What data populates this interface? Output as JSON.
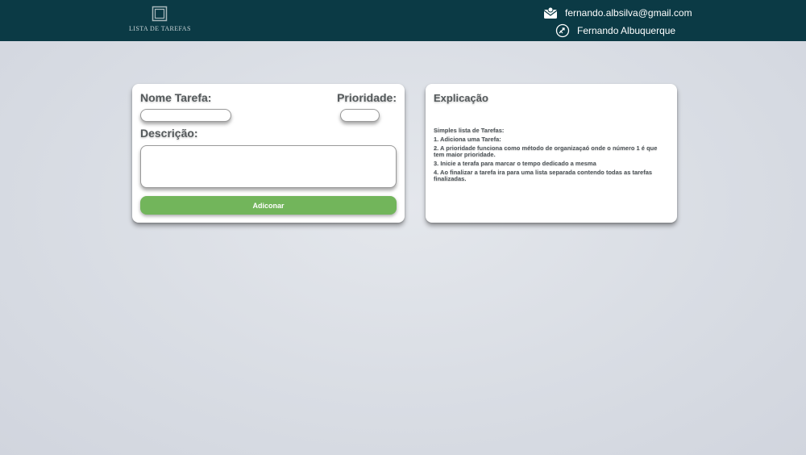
{
  "header": {
    "logo_text": "LISTA DE TAREFAS",
    "user_email": "fernando.albsilva@gmail.com",
    "user_name": "Fernando Albuquerque",
    "background_color": "#0b3a45"
  },
  "form": {
    "name_label": "Nome Tarefa:",
    "priority_label": "Prioridade:",
    "description_label": "Descrição:",
    "name_value": "",
    "priority_value": "",
    "description_value": "",
    "add_button_label": "Adiconar",
    "button_color": "#72b55b"
  },
  "explanation": {
    "title": "Explicação",
    "lines": [
      "Simples lista de Tarefas:",
      "1. Adiciona uma Tarefa:",
      "2. A prioridade funciona como método de organizaçaó onde o número 1 é que tem maior prioridade.",
      "3. Inicie a terafa para marcar o tempo dedicado a mesma",
      "4. Ao finalizar a tarefa ira para uma lista separada contendo todas as tarefas finalizadas."
    ]
  },
  "icons": {
    "logo": "stacked-squares-icon",
    "email": "envelope-person-icon",
    "name": "rocket-globe-icon"
  }
}
